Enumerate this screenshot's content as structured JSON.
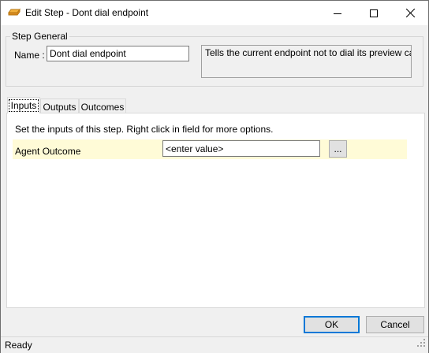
{
  "window": {
    "title": "Edit Step - Dont dial endpoint",
    "icon": "step-icon"
  },
  "step_general": {
    "group_label": "Step General",
    "name_label": "Name :",
    "name_value": "Dont dial endpoint",
    "description": "Tells the current endpoint not to dial its preview call"
  },
  "tabs": [
    {
      "label": "Inputs",
      "active": true
    },
    {
      "label": "Outputs",
      "active": false
    },
    {
      "label": "Outcomes",
      "active": false
    }
  ],
  "inputs_panel": {
    "hint": "Set the inputs of this step.  Right click in field for more options.",
    "params": [
      {
        "label": "Agent Outcome",
        "value": "<enter value>",
        "button_label": "..."
      }
    ]
  },
  "buttons": {
    "ok": "OK",
    "cancel": "Cancel"
  },
  "status": {
    "text": "Ready"
  },
  "colors": {
    "param_row_bg": "#fffbd7",
    "ok_border": "#0078d7"
  }
}
